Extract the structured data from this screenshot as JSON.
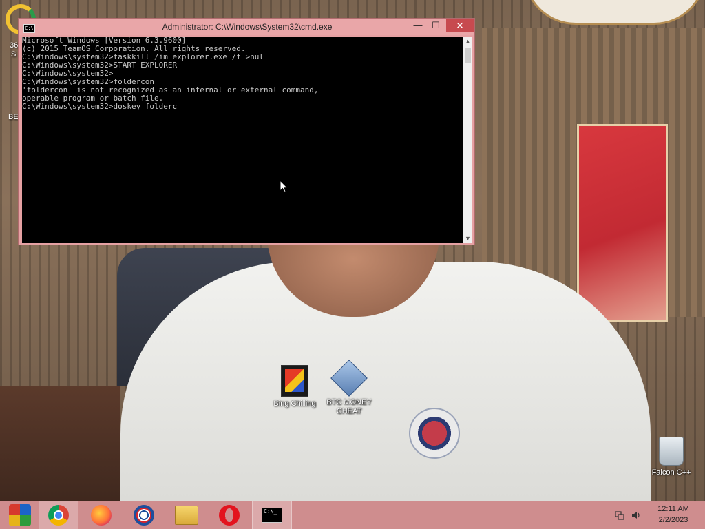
{
  "desktop": {
    "icons": [
      {
        "label": "Bing Chilling"
      },
      {
        "label": "BTC MONEY CHEAT"
      },
      {
        "label": "Falcon C++"
      }
    ],
    "edge_text_1": "36",
    "edge_text_2": "S",
    "edge_text_3": "BE"
  },
  "cmd_window": {
    "title": "Administrator: C:\\Windows\\System32\\cmd.exe",
    "icon_text": "C:\\",
    "buttons": {
      "minimize": "—",
      "maximize": "☐",
      "close": "✕"
    },
    "lines": [
      "Microsoft Windows [Version 6.3.9600]",
      "(c) 2015 TeamOS Corporation. All rights reserved.",
      "",
      "C:\\Windows\\system32>taskkill /im explorer.exe /f >nul",
      "",
      "C:\\Windows\\system32>START EXPLORER",
      "",
      "C:\\Windows\\system32>",
      "C:\\Windows\\system32>foldercon",
      "'foldercon' is not recognized as an internal or external command,",
      "operable program or batch file.",
      "",
      "C:\\Windows\\system32>doskey folderc"
    ],
    "scroll_up": "▲",
    "scroll_down": "▼"
  },
  "taskbar": {
    "apps": [
      {
        "name": "start"
      },
      {
        "name": "chrome"
      },
      {
        "name": "firefox"
      },
      {
        "name": "edge"
      },
      {
        "name": "file-explorer"
      },
      {
        "name": "opera"
      },
      {
        "name": "cmd"
      }
    ],
    "cmd_icon_text": "C:\\_",
    "clock_time": "12:11 AM",
    "clock_date": "2/2/2023"
  },
  "colors": {
    "titlebar": "#e9a6a8",
    "close_button": "#c74a4f",
    "taskbar": "#cf8d8e",
    "console_bg": "#000000",
    "console_text": "#c8c8c8"
  }
}
